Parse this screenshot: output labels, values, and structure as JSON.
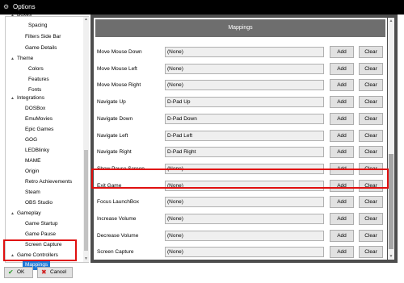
{
  "window": {
    "title": "Options"
  },
  "sidebar": {
    "items": [
      {
        "label": "Boxes",
        "arrow": "▲"
      },
      {
        "label": "Spacing"
      },
      {
        "label": "Filters Side Bar"
      },
      {
        "label": "Game Details"
      },
      {
        "label": "Theme",
        "arrow": "▲"
      },
      {
        "label": "Colors"
      },
      {
        "label": "Features"
      },
      {
        "label": "Fonts"
      },
      {
        "label": "Integrations",
        "arrow": "▲"
      },
      {
        "label": "DOSBox"
      },
      {
        "label": "EmuMovies"
      },
      {
        "label": "Epic Games"
      },
      {
        "label": "GOG"
      },
      {
        "label": "LEDBlinky"
      },
      {
        "label": "MAME"
      },
      {
        "label": "Origin"
      },
      {
        "label": "Retro Achievements"
      },
      {
        "label": "Steam"
      },
      {
        "label": "OBS Studio"
      },
      {
        "label": "Gameplay",
        "arrow": "▲"
      },
      {
        "label": "Game Startup"
      },
      {
        "label": "Game Pause"
      },
      {
        "label": "Screen Capture"
      },
      {
        "label": "Game Controllers",
        "arrow": "▲"
      },
      {
        "label": "Mappings",
        "selected": true
      }
    ]
  },
  "main": {
    "header": "Mappings",
    "add_label": "Add",
    "clear_label": "Clear",
    "rows": [
      {
        "label": "Move Mouse Down",
        "value": "(None)"
      },
      {
        "label": "Move Mouse Left",
        "value": "(None)"
      },
      {
        "label": "Move Mouse Right",
        "value": "(None)"
      },
      {
        "label": "Navigate Up",
        "value": "D-Pad Up"
      },
      {
        "label": "Navigate Down",
        "value": "D-Pad Down"
      },
      {
        "label": "Navigate Left",
        "value": "D-Pad Left"
      },
      {
        "label": "Navigate Right",
        "value": "D-Pad Right"
      },
      {
        "label": "Show Pause Screen",
        "value": "(None)"
      },
      {
        "label": "Exit Game",
        "value": "(None)"
      },
      {
        "label": "Focus LaunchBox",
        "value": "(None)"
      },
      {
        "label": "Increase Volume",
        "value": "(None)"
      },
      {
        "label": "Decrease Volume",
        "value": "(None)"
      },
      {
        "label": "Screen Capture",
        "value": "(None)"
      }
    ]
  },
  "footer": {
    "ok_label": "OK",
    "cancel_label": "Cancel"
  },
  "colors": {
    "highlight": "#e01010",
    "selection": "#1e78d7",
    "ok_check": "#2a9d2a",
    "cancel_x": "#d02020"
  }
}
